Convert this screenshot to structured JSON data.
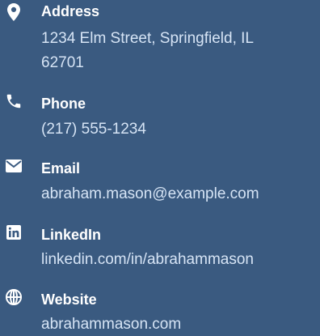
{
  "contact": {
    "address": {
      "icon": "map-marker-icon",
      "label": "Address",
      "value_line1": "1234 Elm Street, Springfield, IL",
      "value_line2": "62701"
    },
    "phone": {
      "icon": "phone-icon",
      "label": "Phone",
      "value": "(217) 555-1234"
    },
    "email": {
      "icon": "envelope-icon",
      "label": "Email",
      "value": "abraham.mason@example.com"
    },
    "linkedin": {
      "icon": "linkedin-icon",
      "label": "LinkedIn",
      "value": "linkedin.com/in/abrahammason"
    },
    "website": {
      "icon": "globe-icon",
      "label": "Website",
      "value": "abrahammason.com"
    }
  },
  "colors": {
    "background": "#3a5a80",
    "label": "#ffffff",
    "value": "#d6e4f5"
  }
}
